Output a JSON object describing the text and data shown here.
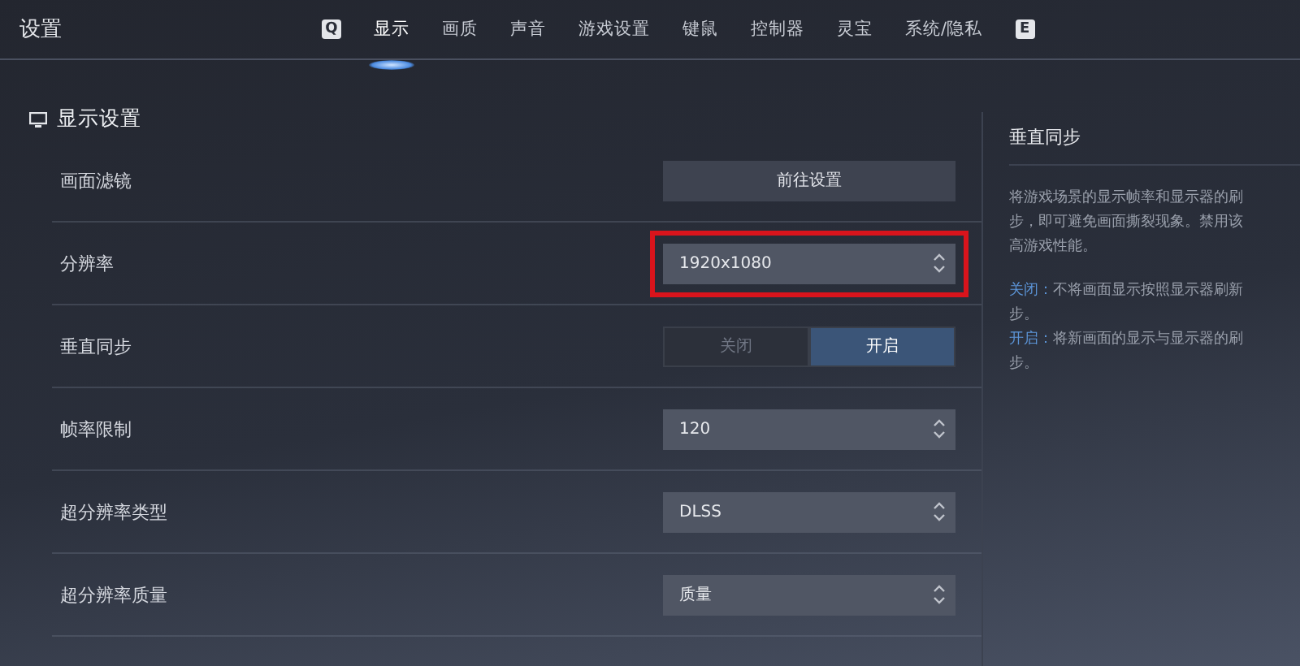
{
  "title": "设置",
  "tabs": [
    {
      "label": "Q",
      "kind": "key"
    },
    {
      "label": "显示",
      "kind": "tab",
      "selected": true
    },
    {
      "label": "画质",
      "kind": "tab",
      "selected": false
    },
    {
      "label": "声音",
      "kind": "tab",
      "selected": false
    },
    {
      "label": "游戏设置",
      "kind": "tab",
      "selected": false
    },
    {
      "label": "键鼠",
      "kind": "tab",
      "selected": false
    },
    {
      "label": "控制器",
      "kind": "tab",
      "selected": false
    },
    {
      "label": "灵宝",
      "kind": "tab",
      "selected": false
    },
    {
      "label": "系统/隐私",
      "kind": "tab",
      "selected": false
    },
    {
      "label": "E",
      "kind": "key"
    }
  ],
  "section": {
    "title": "显示设置"
  },
  "rows": [
    {
      "label": "画面滤镜",
      "kind": "button",
      "value": "前往设置",
      "highlighted": false
    },
    {
      "label": "分辨率",
      "kind": "select",
      "value": "1920x1080",
      "highlighted": true
    },
    {
      "label": "垂直同步",
      "kind": "toggle",
      "options": [
        {
          "label": "关闭",
          "selected": false
        },
        {
          "label": "开启",
          "selected": true
        }
      ],
      "highlighted": false
    },
    {
      "label": "帧率限制",
      "kind": "select",
      "value": "120",
      "highlighted": false
    },
    {
      "label": "超分辨率类型",
      "kind": "select",
      "value": "DLSS",
      "highlighted": false
    },
    {
      "label": "超分辨率质量",
      "kind": "select",
      "value": "质量",
      "highlighted": false
    }
  ],
  "help": {
    "title": "垂直同步",
    "lines": [
      "将游戏场景的显示帧率和显示器的刷",
      "步，即可避免画面撕裂现象。禁用该",
      "高游戏性能。"
    ],
    "notes": [
      {
        "label": "关闭：",
        "lines": [
          "不将画面显示按照显示器刷新",
          "步。"
        ]
      },
      {
        "label": "开启：",
        "lines": [
          "将新画面的显示与显示器的刷",
          "步。"
        ]
      }
    ]
  }
}
